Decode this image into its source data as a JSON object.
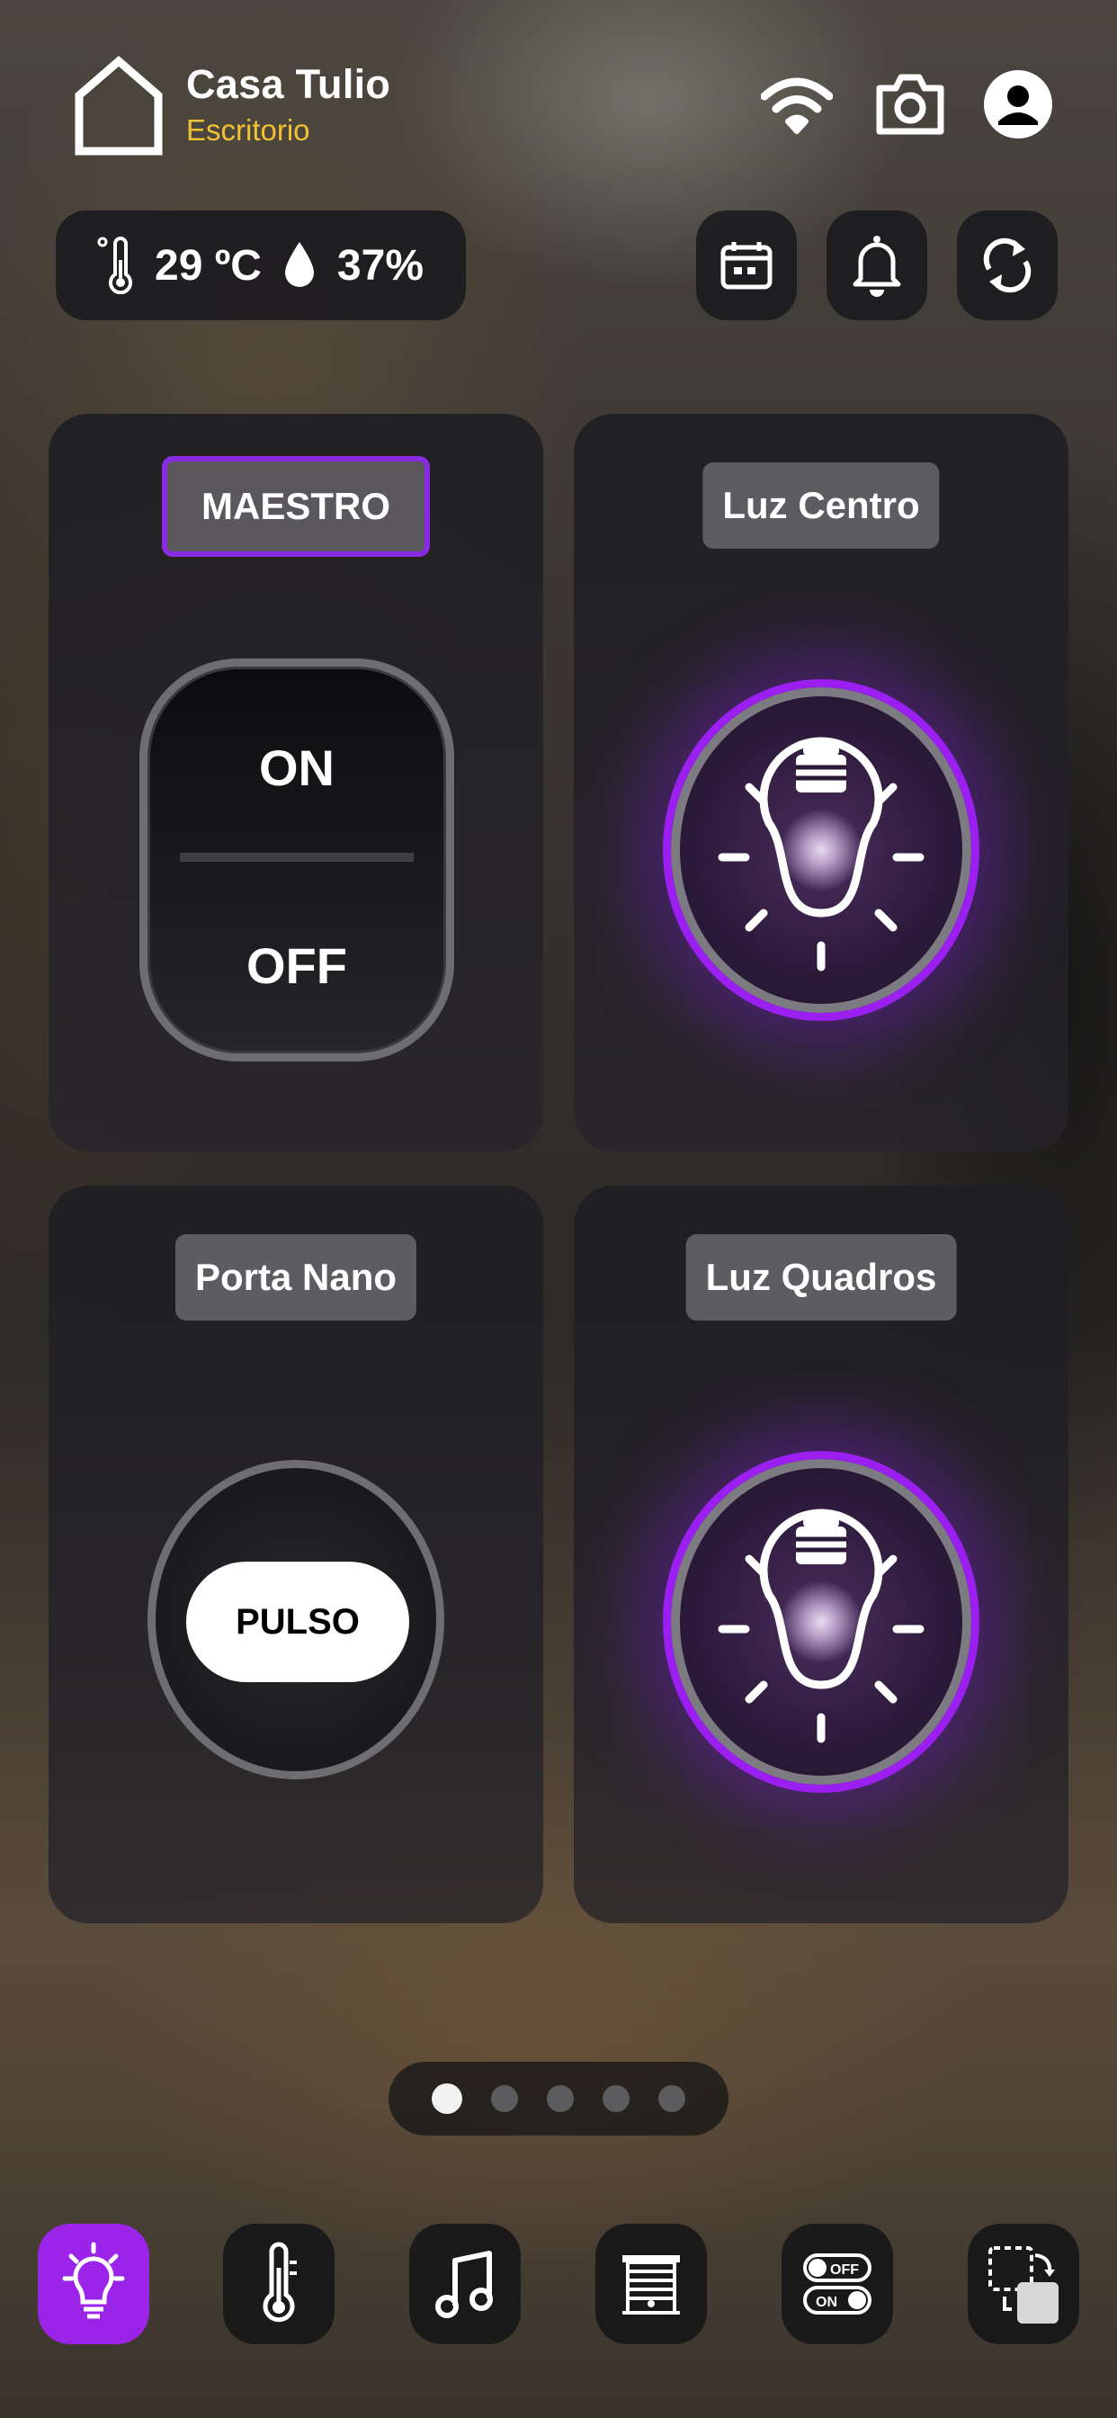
{
  "header": {
    "title": "Casa Tulio",
    "subtitle": "Escritorio",
    "icons": [
      "home-icon",
      "wifi-icon",
      "camera-icon",
      "user-icon"
    ]
  },
  "climate": {
    "temperature": "29 ºC",
    "humidity": "37%",
    "icons": [
      "thermometer-icon",
      "drop-icon"
    ]
  },
  "toolbar": [
    "calendar-icon",
    "bell-icon",
    "refresh-icon"
  ],
  "cards": [
    {
      "label": "MAESTRO",
      "type": "switch",
      "on_label": "ON",
      "off_label": "OFF",
      "selected": true
    },
    {
      "label": "Luz Centro",
      "type": "light"
    },
    {
      "label": "Porta Nano",
      "type": "pulse",
      "button_label": "PULSO"
    },
    {
      "label": "Luz Quadros",
      "type": "light"
    }
  ],
  "pager": {
    "pages": 5,
    "current": 1
  },
  "bottom_nav": [
    "lights-icon",
    "thermometer-icon",
    "music-icon",
    "shutter-icon",
    "switches-icon",
    "scenes-icon"
  ],
  "colors": {
    "accent": "#9b24e8",
    "subtitle": "#f2c233",
    "card_bg": "#1e1e22"
  }
}
